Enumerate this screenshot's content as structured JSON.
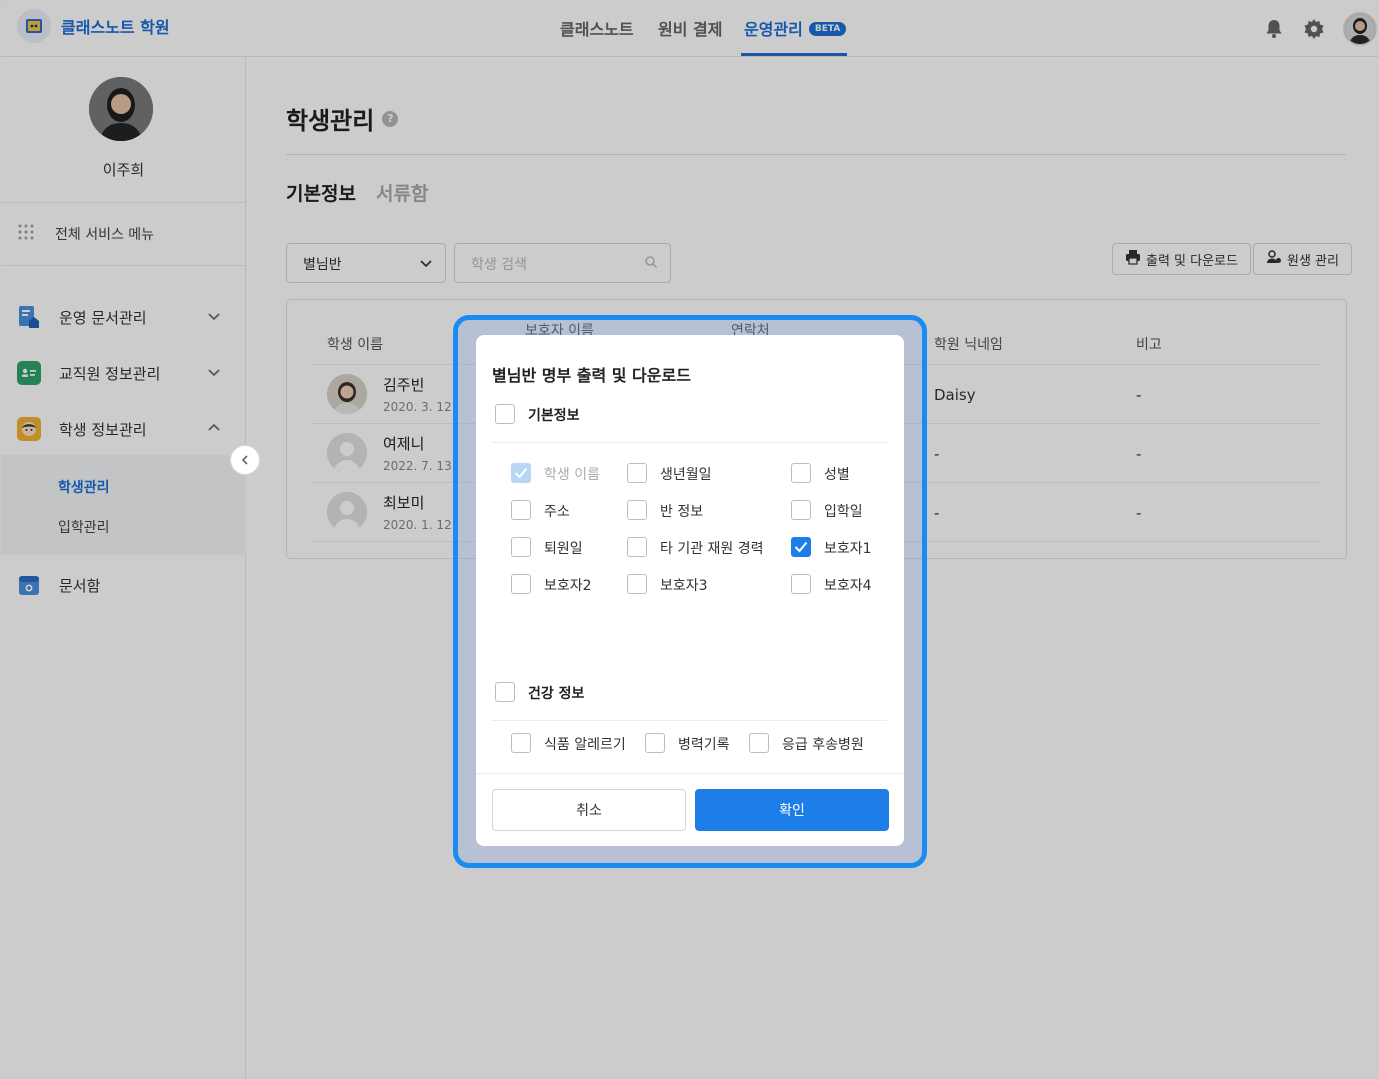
{
  "header": {
    "brand": "클래스노트 학원",
    "nav": [
      "클래스노트",
      "원비 결제",
      "운영관리"
    ],
    "beta": "BETA"
  },
  "sidebar": {
    "user_name": "이주희",
    "all_menu": "전체 서비스 메뉴",
    "items": [
      "운영 문서관리",
      "교직원 정보관리",
      "학생 정보관리"
    ],
    "sub_items": [
      "학생관리",
      "입학관리"
    ],
    "docbox": "문서함"
  },
  "main": {
    "title": "학생관리",
    "help": "?",
    "tabs": [
      "기본정보",
      "서류함"
    ],
    "class_select": "별님반",
    "search_placeholder": "학생 검색",
    "print_button": "출력 및 다운로드",
    "member_button": "원생 관리",
    "table_headers": [
      "학생 이름",
      "보호자 이름",
      "연락처",
      "학원 닉네임",
      "비고"
    ],
    "rows": [
      {
        "name": "김주빈",
        "date": "2020. 3. 12.",
        "nickname": "Daisy",
        "note": "-"
      },
      {
        "name": "여제니",
        "date": "2022. 7. 13.",
        "nickname": "-",
        "note": "-"
      },
      {
        "name": "최보미",
        "date": "2020. 1. 12.",
        "nickname": "-",
        "note": "-"
      }
    ]
  },
  "modal": {
    "title": "별님반 명부 출력 및 다운로드",
    "section1": "기본정보",
    "options1": [
      {
        "label": "학생 이름",
        "checked": true,
        "disabled": true
      },
      {
        "label": "생년월일",
        "checked": false
      },
      {
        "label": "성별",
        "checked": false
      },
      {
        "label": "주소",
        "checked": false
      },
      {
        "label": "반 정보",
        "checked": false
      },
      {
        "label": "입학일",
        "checked": false
      },
      {
        "label": "퇴원일",
        "checked": false
      },
      {
        "label": "타 기관 재원 경력",
        "checked": false
      },
      {
        "label": "보호자1",
        "checked": true
      },
      {
        "label": "보호자2",
        "checked": false
      },
      {
        "label": "보호자3",
        "checked": false
      },
      {
        "label": "보호자4",
        "checked": false
      }
    ],
    "section2": "건강 정보",
    "options2": [
      {
        "label": "식품 알레르기",
        "checked": false
      },
      {
        "label": "병력기록",
        "checked": false
      },
      {
        "label": "응급 후송병원",
        "checked": false
      }
    ],
    "cancel": "취소",
    "confirm": "확인"
  },
  "colors": {
    "accent": "#1d7ee8",
    "brand": "#1d6fd8",
    "ring": "#1a8bf0"
  }
}
